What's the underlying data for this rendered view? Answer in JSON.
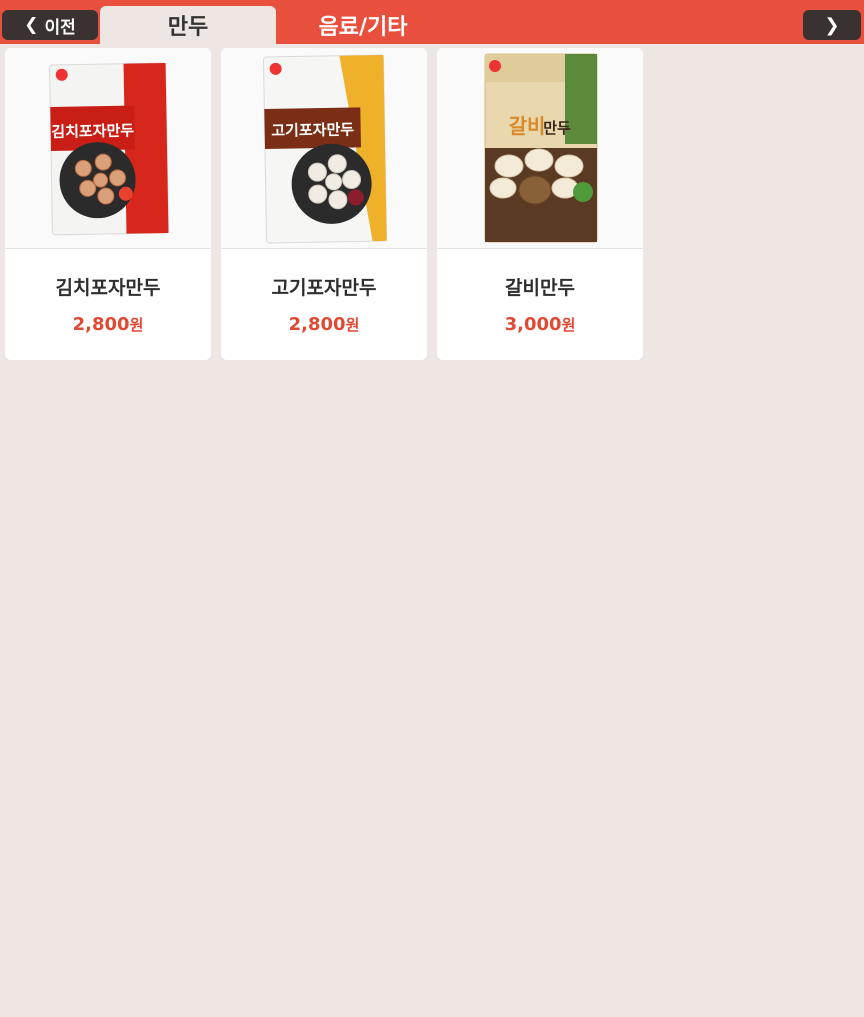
{
  "nav": {
    "prev_label": "이전",
    "next_icon": "chevron-right-icon"
  },
  "tabs": [
    {
      "label": "만두",
      "active": true
    },
    {
      "label": "음료/기타",
      "active": false
    }
  ],
  "products": [
    {
      "name": "김치포자만두",
      "price": "2,800",
      "currency": "원",
      "brand_text": "김치포자만두",
      "accent": "#d7261c"
    },
    {
      "name": "고기포자만두",
      "price": "2,800",
      "currency": "원",
      "brand_text": "고기포자만두",
      "accent": "#7a2e16"
    },
    {
      "name": "갈비만두",
      "price": "3,000",
      "currency": "원",
      "brand_text": "갈비만두",
      "accent": "#e0b062"
    }
  ],
  "colors": {
    "topbar": "#e84f3d",
    "button": "#3a3230",
    "price": "#e04a34",
    "background": "#ede6e3"
  }
}
